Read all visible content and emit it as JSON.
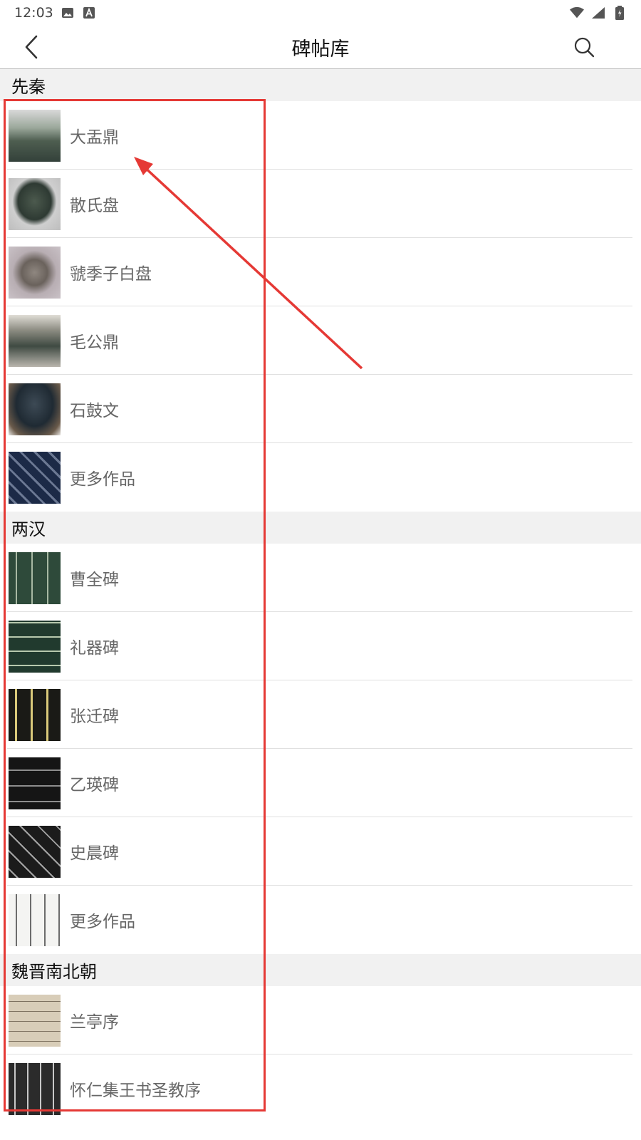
{
  "status_bar": {
    "time": "12:03",
    "icons": [
      "image-icon",
      "a-icon",
      "wifi-icon",
      "signal-icon",
      "battery-icon"
    ]
  },
  "app_bar": {
    "title": "碑帖库",
    "back_icon": "back-arrow-icon",
    "search_icon": "search-icon"
  },
  "sections": [
    {
      "title": "先秦",
      "items": [
        {
          "label": "大盂鼎"
        },
        {
          "label": "散氏盘"
        },
        {
          "label": "虢季子白盘"
        },
        {
          "label": "毛公鼎"
        },
        {
          "label": "石鼓文"
        },
        {
          "label": "更多作品"
        }
      ]
    },
    {
      "title": "两汉",
      "items": [
        {
          "label": "曹全碑"
        },
        {
          "label": "礼器碑"
        },
        {
          "label": "张迁碑"
        },
        {
          "label": "乙瑛碑"
        },
        {
          "label": "史晨碑"
        },
        {
          "label": "更多作品"
        }
      ]
    },
    {
      "title": "魏晋南北朝",
      "items": [
        {
          "label": "兰亭序"
        },
        {
          "label": "怀仁集王书圣教序"
        }
      ]
    }
  ],
  "annotation": {
    "color": "#e53935"
  }
}
